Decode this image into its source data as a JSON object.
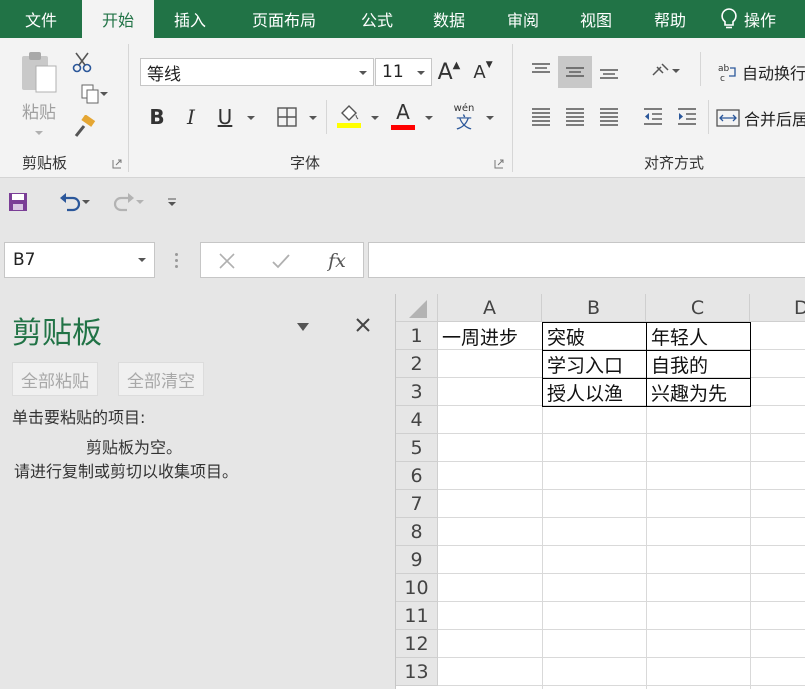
{
  "tabs": [
    "文件",
    "开始",
    "插入",
    "页面布局",
    "公式",
    "数据",
    "审阅",
    "视图",
    "帮助",
    "操作"
  ],
  "active_tab": 1,
  "ribbon": {
    "clipboard": {
      "paste_label": "粘贴",
      "group_label": "剪贴板"
    },
    "font": {
      "font_name": "等线",
      "font_size": "11",
      "group_label": "字体",
      "bold": "B",
      "italic": "I",
      "underline": "U",
      "phonetic_top": "wén",
      "phonetic_bottom": "文",
      "grow": "A",
      "shrink": "A",
      "font_color_letter": "A"
    },
    "alignment": {
      "wrap_label": "自动换行",
      "merge_label": "合并后居",
      "group_label": "对齐方式"
    }
  },
  "colors": {
    "excel_green": "#217346",
    "highlight": "#ffff00",
    "font_red": "#ff0000"
  },
  "name_box": "B7",
  "formula_bar": {
    "fx": "fx",
    "value": ""
  },
  "clipboard_pane": {
    "title": "剪贴板",
    "paste_all": "全部粘贴",
    "clear_all": "全部清空",
    "prompt": "单击要粘贴的项目:",
    "empty_line1": "剪贴板为空。",
    "empty_line2": "请进行复制或剪切以收集项目。"
  },
  "sheet": {
    "columns": [
      "A",
      "B",
      "C",
      "D"
    ],
    "rows": [
      "1",
      "2",
      "3",
      "4",
      "5",
      "6",
      "7",
      "8",
      "9",
      "10",
      "11",
      "12",
      "13"
    ],
    "cells": {
      "A1": "一周进步",
      "B1": "突破",
      "C1": "年轻人",
      "B2": "学习入口",
      "C2": "自我的",
      "B3": "授人以渔",
      "C3": "兴趣为先"
    }
  }
}
